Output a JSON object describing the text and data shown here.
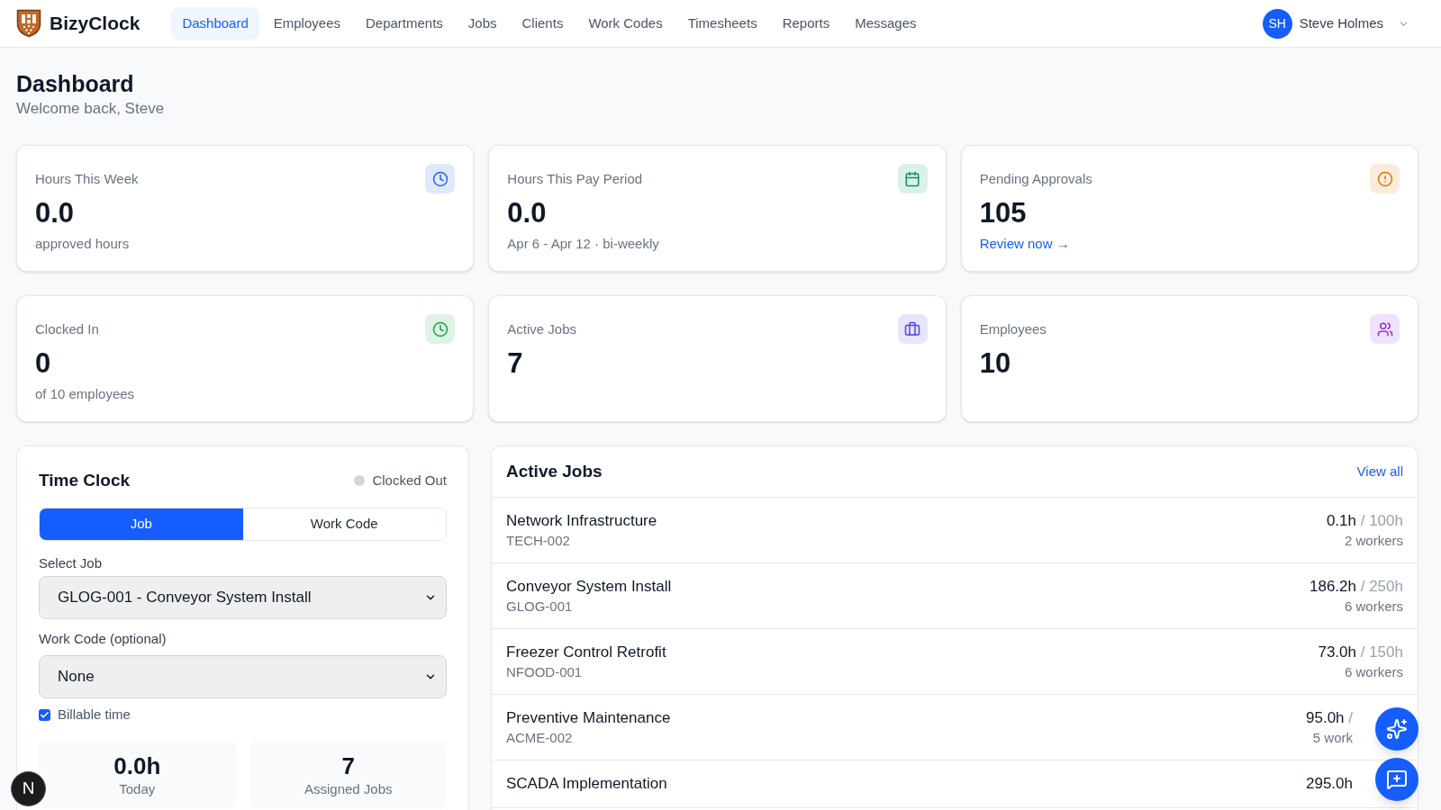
{
  "app": {
    "name": "BizyClock"
  },
  "nav": [
    {
      "label": "Dashboard",
      "selected": true
    },
    {
      "label": "Employees",
      "selected": false
    },
    {
      "label": "Departments",
      "selected": false
    },
    {
      "label": "Jobs",
      "selected": false
    },
    {
      "label": "Clients",
      "selected": false
    },
    {
      "label": "Work Codes",
      "selected": false
    },
    {
      "label": "Timesheets",
      "selected": false
    },
    {
      "label": "Reports",
      "selected": false
    },
    {
      "label": "Messages",
      "selected": false
    }
  ],
  "user": {
    "initials": "SH",
    "name": "Steve Holmes"
  },
  "page": {
    "title": "Dashboard",
    "subtitle": "Welcome back, Steve"
  },
  "stats": [
    {
      "label": "Hours This Week",
      "value": "0.0",
      "note": "approved hours",
      "color": "#2563eb"
    },
    {
      "label": "Hours This Pay Period",
      "value": "0.0",
      "note": "Apr 6 - Apr 12 · bi-weekly",
      "color": "#059669"
    },
    {
      "label": "Pending Approvals",
      "value": "105",
      "link": "Review now →",
      "color": "#d97706"
    },
    {
      "label": "Clocked In",
      "value": "0",
      "note": "of 10 employees",
      "color": "#16a34a"
    },
    {
      "label": "Active Jobs",
      "value": "7",
      "color": "#4f46e5"
    },
    {
      "label": "Employees",
      "value": "10",
      "color": "#9333ea"
    }
  ],
  "time_clock": {
    "title": "Time Clock",
    "status": {
      "label": "Clocked Out",
      "clocked_in": false
    },
    "modes": [
      {
        "label": "Job",
        "selected": true
      },
      {
        "label": "Work Code",
        "selected": false
      }
    ],
    "job_field": {
      "label": "Select Job",
      "value": "GLOG-001 - Conveyor System Install"
    },
    "work_code_field": {
      "label": "Work Code (optional)",
      "value": "None"
    },
    "billable": {
      "label": "Billable time",
      "checked": true
    },
    "summary": [
      {
        "value": "0.0h",
        "label": "Today"
      },
      {
        "value": "7",
        "label": "Assigned Jobs"
      }
    ]
  },
  "active_jobs": {
    "title": "Active Jobs",
    "link": "View all",
    "rows": [
      {
        "name": "Network Infrastructure",
        "code": "TECH-002",
        "hours": "0.1h",
        "budget": "/ 100h",
        "workers": "2 workers"
      },
      {
        "name": "Conveyor System Install",
        "code": "GLOG-001",
        "hours": "186.2h",
        "budget": "/ 250h",
        "workers": "6 workers"
      },
      {
        "name": "Freezer Control Retrofit",
        "code": "NFOOD-001",
        "hours": "73.0h",
        "budget": "/ 150h",
        "workers": "6 workers"
      },
      {
        "name": "Preventive Maintenance",
        "code": "ACME-002",
        "hours": "95.0h",
        "budget": "/",
        "workers": "5 work"
      },
      {
        "name": "SCADA Implementation",
        "hours": "295.0h"
      }
    ]
  },
  "dev_badge": {
    "label": "N"
  }
}
